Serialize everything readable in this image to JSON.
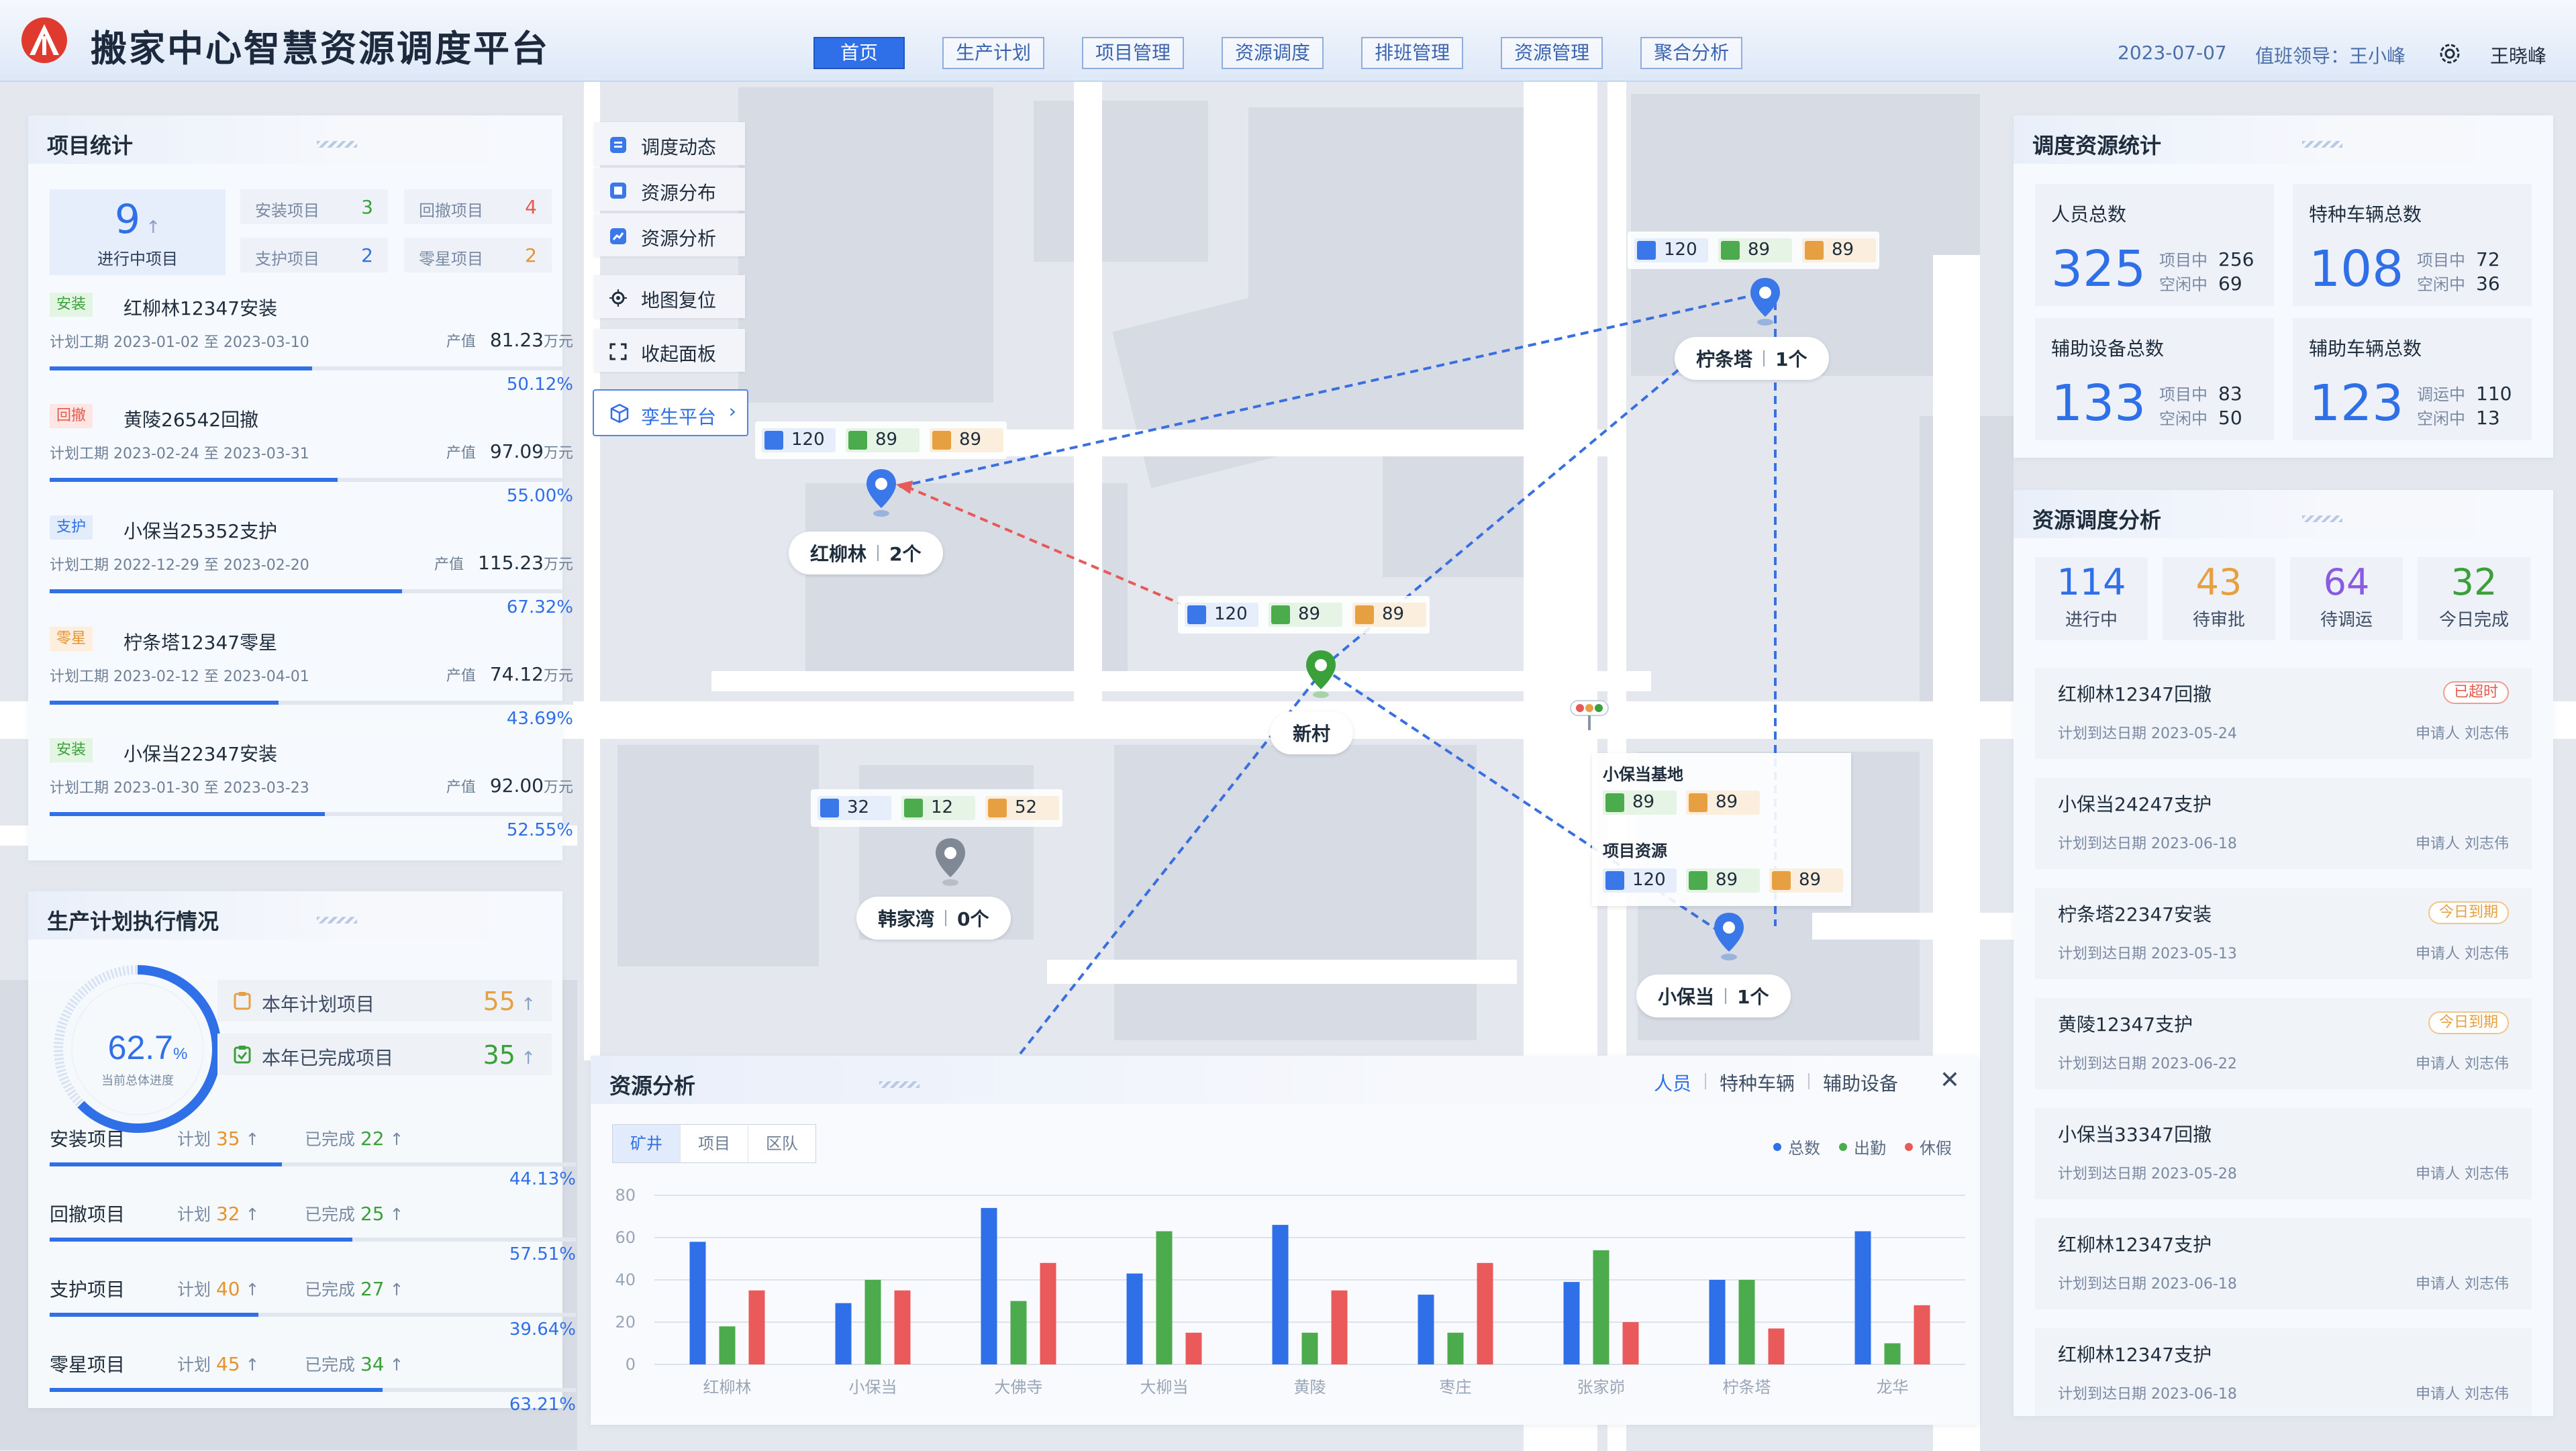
{
  "header": {
    "title": "搬家中心智慧资源调度平台",
    "date": "2023-07-07",
    "duty": "值班领导：王小峰",
    "user": "王晓峰",
    "nav": [
      "首页",
      "生产计划",
      "项目管理",
      "资源调度",
      "排班管理",
      "资源管理",
      "聚合分析"
    ]
  },
  "project_stats": {
    "title": "项目统计",
    "ongoing_value": "9",
    "ongoing_label": "进行中项目",
    "small": [
      {
        "label": "安装项目",
        "value": "3",
        "color": "#3aa03a"
      },
      {
        "label": "回撤项目",
        "value": "4",
        "color": "#e45a4e"
      },
      {
        "label": "支护项目",
        "value": "2",
        "color": "#2f6fe8"
      },
      {
        "label": "零星项目",
        "value": "2",
        "color": "#e6922e"
      }
    ],
    "projects": [
      {
        "tag": "安装",
        "tag_class": "t-green",
        "name": "红柳林12347安装",
        "date": "计划工期   2023-01-02 至 2023-03-10",
        "out_label": "产值",
        "out_value": "81.23",
        "out_unit": "万元",
        "pct": "50.12%",
        "progress": 0.5012
      },
      {
        "tag": "回撤",
        "tag_class": "t-red",
        "name": "黄陵26542回撤",
        "date": "计划工期   2023-02-24 至 2023-03-31",
        "out_label": "产值",
        "out_value": "97.09",
        "out_unit": "万元",
        "pct": "55.00%",
        "progress": 0.55
      },
      {
        "tag": "支护",
        "tag_class": "t-blue",
        "name": "小保当25352支护",
        "date": "计划工期   2022-12-29 至 2023-02-20",
        "out_label": "产值",
        "out_value": "115.23",
        "out_unit": "万元",
        "pct": "67.32%",
        "progress": 0.6732
      },
      {
        "tag": "零星",
        "tag_class": "t-orange",
        "name": "柠条塔12347零星",
        "date": "计划工期   2023-02-12 至 2023-04-01",
        "out_label": "产值",
        "out_value": "74.12",
        "out_unit": "万元",
        "pct": "43.69%",
        "progress": 0.4369
      },
      {
        "tag": "安装",
        "tag_class": "t-green",
        "name": "小保当22347安装",
        "date": "计划工期   2023-01-30 至 2023-03-23",
        "out_label": "产值",
        "out_value": "92.00",
        "out_unit": "万元",
        "pct": "52.55%",
        "progress": 0.5255
      }
    ]
  },
  "plan": {
    "title": "生产计划执行情况",
    "gauge_value": "62.7",
    "gauge_unit": "%",
    "gauge_label": "当前总体进度",
    "gauge_progress": 0.627,
    "rows": [
      {
        "label": "本年计划项目",
        "value": "55",
        "color": "#e6a041"
      },
      {
        "label": "本年已完成项目",
        "value": "35",
        "color": "#3aa03a"
      }
    ],
    "items": [
      {
        "name": "安装项目",
        "plan_label": "计划",
        "plan": "35",
        "done_label": "已完成",
        "done": "22",
        "pct": "44.13%",
        "progress": 0.4413
      },
      {
        "name": "回撤项目",
        "plan_label": "计划",
        "plan": "32",
        "done_label": "已完成",
        "done": "25",
        "pct": "57.51%",
        "progress": 0.5751
      },
      {
        "name": "支护项目",
        "plan_label": "计划",
        "plan": "40",
        "done_label": "已完成",
        "done": "27",
        "pct": "39.64%",
        "progress": 0.3964
      },
      {
        "name": "零星项目",
        "plan_label": "计划",
        "plan": "45",
        "done_label": "已完成",
        "done": "34",
        "pct": "63.21%",
        "progress": 0.6321
      }
    ]
  },
  "map_menu": [
    "调度动态",
    "资源分布",
    "资源分析",
    "地图复位",
    "收起面板"
  ],
  "twin_button": "孪生平台",
  "sites": [
    {
      "name": "红柳林",
      "count": "2个",
      "chips": [
        "120",
        "89",
        "89"
      ]
    },
    {
      "name": "柠条塔",
      "count": "1个",
      "chips": [
        "120",
        "89",
        "89"
      ]
    },
    {
      "name": "新村",
      "count": "",
      "chips": [
        "120",
        "89",
        "89"
      ]
    },
    {
      "name": "韩家湾",
      "count": "0个",
      "chips": [
        "32",
        "12",
        "52"
      ]
    },
    {
      "name": "小保当",
      "count": "1个",
      "chips": []
    }
  ],
  "info_card": {
    "base_title": "小保当基地",
    "base_chips": [
      "89",
      "89"
    ],
    "res_title": "项目资源",
    "res_chips": [
      "120",
      "89",
      "89"
    ]
  },
  "bottom": {
    "title": "资源分析",
    "tabs": [
      "人员",
      "特种车辆",
      "辅助设备"
    ],
    "seg": [
      "矿井",
      "项目",
      "区队"
    ]
  },
  "chart_data": {
    "type": "bar",
    "categories": [
      "红柳林",
      "小保当",
      "大佛寺",
      "大柳当",
      "黄陵",
      "枣庄",
      "张家峁",
      "柠条塔",
      "龙华"
    ],
    "series": [
      {
        "name": "总数",
        "color": "#2f6fe8",
        "values": [
          58,
          29,
          74,
          43,
          66,
          33,
          39,
          40,
          63
        ]
      },
      {
        "name": "出勤",
        "color": "#4cab4c",
        "values": [
          18,
          40,
          30,
          63,
          15,
          15,
          54,
          40,
          10
        ]
      },
      {
        "name": "休假",
        "color": "#ea5a5a",
        "values": [
          35,
          35,
          48,
          15,
          35,
          48,
          20,
          17,
          28
        ]
      }
    ],
    "ylim": [
      0,
      80
    ],
    "yticks": [
      "0",
      "20",
      "40",
      "60",
      "80"
    ]
  },
  "resource_stats": {
    "title": "调度资源统计",
    "cards": [
      {
        "label": "人员总数",
        "value": "325",
        "l1": "项目中",
        "v1": "256",
        "l2": "空闲中",
        "v2": "69"
      },
      {
        "label": "特种车辆总数",
        "value": "108",
        "l1": "项目中",
        "v1": "72",
        "l2": "空闲中",
        "v2": "36"
      },
      {
        "label": "辅助设备总数",
        "value": "133",
        "l1": "项目中",
        "v1": "83",
        "l2": "空闲中",
        "v2": "50"
      },
      {
        "label": "辅助车辆总数",
        "value": "123",
        "l1": "调运中",
        "v1": "110",
        "l2": "空闲中",
        "v2": "13"
      }
    ]
  },
  "dispatch": {
    "title": "资源调度分析",
    "stats": [
      {
        "value": "114",
        "label": "进行中",
        "color": "#2f6fe8"
      },
      {
        "value": "43",
        "label": "待审批",
        "color": "#e6a041"
      },
      {
        "value": "64",
        "label": "待调运",
        "color": "#8a5be0"
      },
      {
        "value": "32",
        "label": "今日完成",
        "color": "#3aa03a"
      }
    ],
    "requests": [
      {
        "name": "红柳林12347回撤",
        "date": "计划到达日期   2023-05-24",
        "applicant": "申请人   刘志伟",
        "badge": "已超时",
        "badge_class": "b-red"
      },
      {
        "name": "小保当24247支护",
        "date": "计划到达日期   2023-06-18",
        "applicant": "申请人   刘志伟",
        "badge": "",
        "badge_class": ""
      },
      {
        "name": "柠条塔22347安装",
        "date": "计划到达日期   2023-05-13",
        "applicant": "申请人   刘志伟",
        "badge": "今日到期",
        "badge_class": "b-orange"
      },
      {
        "name": "黄陵12347支护",
        "date": "计划到达日期   2023-06-22",
        "applicant": "申请人   刘志伟",
        "badge": "今日到期",
        "badge_class": "b-orange"
      },
      {
        "name": "小保当33347回撤",
        "date": "计划到达日期   2023-05-28",
        "applicant": "申请人   刘志伟",
        "badge": "",
        "badge_class": ""
      },
      {
        "name": "红柳林12347支护",
        "date": "计划到达日期   2023-06-18",
        "applicant": "申请人   刘志伟",
        "badge": "",
        "badge_class": ""
      },
      {
        "name": "红柳林12347支护",
        "date": "计划到达日期   2023-06-18",
        "applicant": "申请人   刘志伟",
        "badge": "",
        "badge_class": ""
      }
    ]
  }
}
